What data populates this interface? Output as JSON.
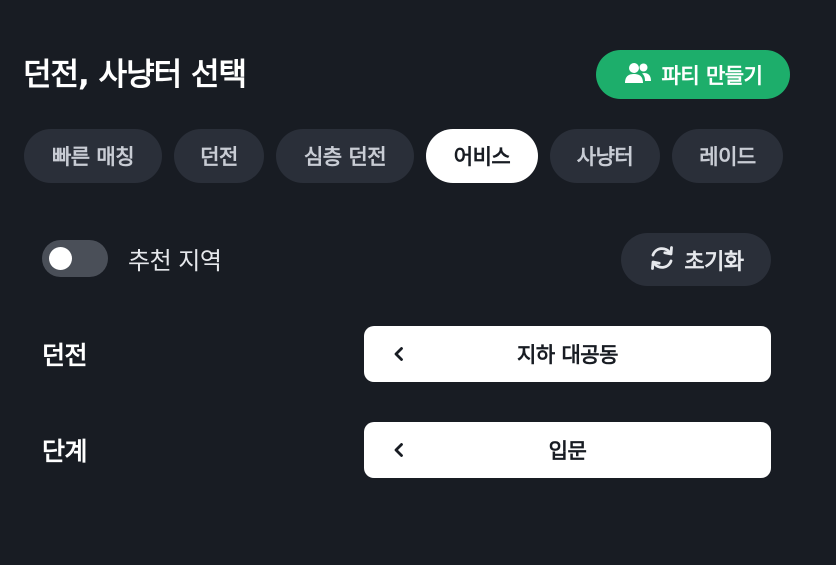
{
  "header": {
    "title": "던전, 사냥터 선택",
    "party_button_label": "파티 만들기",
    "party_icon": "users-icon"
  },
  "tabs": [
    {
      "label": "빠른 매칭",
      "active": false
    },
    {
      "label": "던전",
      "active": false
    },
    {
      "label": "심층 던전",
      "active": false
    },
    {
      "label": "어비스",
      "active": true
    },
    {
      "label": "사냥터",
      "active": false
    },
    {
      "label": "레이드",
      "active": false
    }
  ],
  "filters": {
    "recommended_label": "추천 지역",
    "recommended_on": false,
    "reset_label": "초기화",
    "reset_icon": "refresh-icon"
  },
  "selectors": [
    {
      "label": "던전",
      "value": "지하 대공동",
      "icon": "chevron-left-icon"
    },
    {
      "label": "단계",
      "value": "입문",
      "icon": "chevron-left-icon"
    }
  ],
  "colors": {
    "background": "#181c23",
    "accent": "#1dae6b",
    "tab_inactive": "#2a2f39",
    "tab_active": "#ffffff"
  }
}
